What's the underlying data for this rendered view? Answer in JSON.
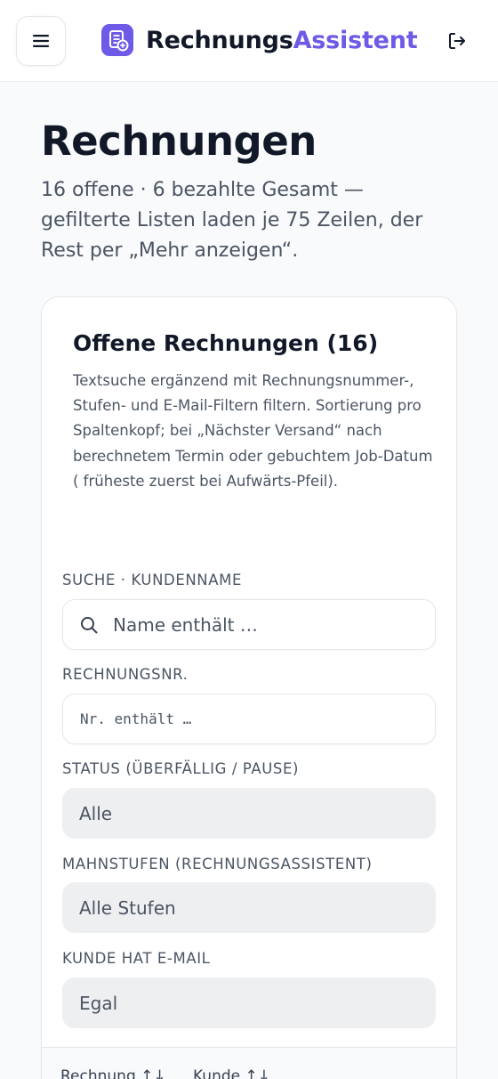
{
  "header": {
    "brand_part1": "Rechnungs",
    "brand_part2": "Assistent",
    "menu_icon": "menu-icon",
    "logout_icon": "logout-icon",
    "brand_color": "#6d5ae6"
  },
  "page": {
    "title": "Rechnungen",
    "subtitle": "16 offene · 6 bezahlte Gesamt — gefilterte Listen laden je 75 Zeilen, der Rest per „Mehr anzeigen“."
  },
  "open_invoices": {
    "title": "Offene Rechnungen (16)",
    "description": "Textsuche ergänzend mit Rechnungsnummer-, Stufen- und E-Mail-Filtern filtern. Sortierung pro Spaltenkopf; bei „Nächster Versand“ nach berechnetem Termin oder gebuchtem Job-Datum ( früheste zuerst bei Aufwärts-Pfeil).",
    "filters": {
      "search_label": "Suche · Kundenname",
      "search_placeholder": "Name enthält …",
      "invoice_no_label": "Rechnungsnr.",
      "invoice_no_placeholder": "Nr. enthält …",
      "status_label": "Status (überfällig / Pause)",
      "status_value": "Alle",
      "stages_label": "Mahnstufen (Rechnungsassistent)",
      "stages_value": "Alle Stufen",
      "email_label": "Kunde hat E-Mail",
      "email_value": "Egal"
    },
    "table": {
      "columns": [
        "Rechnung ↑↓",
        "Kunde ↑↓"
      ]
    }
  }
}
